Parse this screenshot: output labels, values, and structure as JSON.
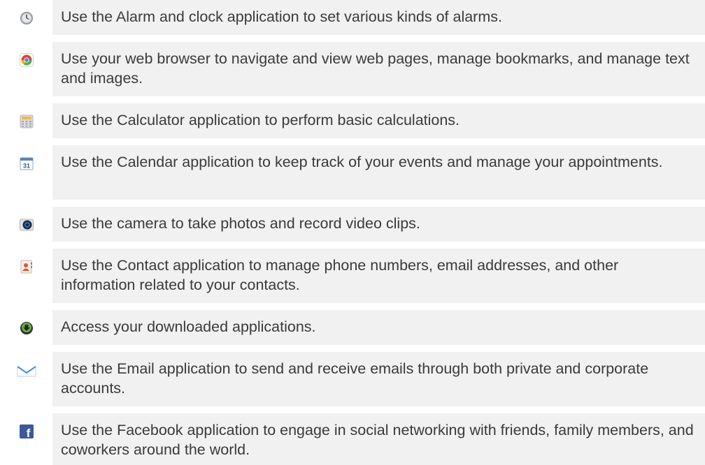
{
  "items": [
    {
      "icon": "alarm-clock-icon",
      "text": "Use the Alarm and clock application to set various kinds of alarms."
    },
    {
      "icon": "browser-icon",
      "text": "Use your web browser to navigate and view web pages, manage bookmarks, and manage text and images."
    },
    {
      "icon": "calculator-icon",
      "text": "Use the Calculator application to perform basic calculations."
    },
    {
      "icon": "calendar-icon",
      "text": "Use the Calendar application to keep track of your events and manage your appointments.",
      "icon_label": "31"
    },
    {
      "icon": "camera-icon",
      "text": "Use the camera to take photos and record video clips."
    },
    {
      "icon": "contacts-icon",
      "text": "Use the Contact application to manage phone numbers, email addresses, and other information related to your contacts."
    },
    {
      "icon": "downloads-icon",
      "text": "Access your downloaded applications."
    },
    {
      "icon": "email-icon",
      "text": "Use the Email application to send and receive emails through both private and corporate accounts."
    },
    {
      "icon": "facebook-icon",
      "text": "Use the Facebook application to engage in social networking with friends, family members, and coworkers around the world.",
      "icon_label": "f"
    }
  ]
}
